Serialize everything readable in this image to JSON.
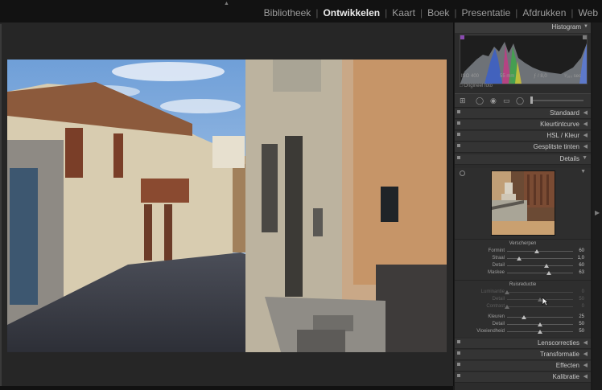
{
  "modules": {
    "items": [
      {
        "label": "Bibliotheek",
        "active": false
      },
      {
        "label": "Ontwikkelen",
        "active": true
      },
      {
        "label": "Kaart",
        "active": false
      },
      {
        "label": "Boek",
        "active": false
      },
      {
        "label": "Presentatie",
        "active": false
      },
      {
        "label": "Afdrukken",
        "active": false
      },
      {
        "label": "Web",
        "active": false
      }
    ],
    "separator": "|"
  },
  "histogram": {
    "title": "Histogram",
    "iso": "ISO 400",
    "focal": "55 mm",
    "aperture": "ƒ / 8,0",
    "shutter": "¹⁄₁₆₀ sec",
    "original_label": "Origineel foto"
  },
  "tool_icons": [
    "crop-icon",
    "spot-removal-icon",
    "red-eye-icon",
    "graduated-filter-icon",
    "radial-filter-icon",
    "adjustment-brush-icon"
  ],
  "sections_top": [
    {
      "label": "Standaard"
    },
    {
      "label": "Kleurtintcurve"
    },
    {
      "label": "HSL / Kleur"
    },
    {
      "label": "Gesplitste tinten"
    },
    {
      "label": "Details"
    }
  ],
  "details": {
    "sharpen": {
      "title": "Verscherpen",
      "rows": [
        {
          "label": "Formint",
          "value": "60",
          "pos": 0.45
        },
        {
          "label": "Straal",
          "value": "1,0",
          "pos": 0.18
        },
        {
          "label": "Detail",
          "value": "60",
          "pos": 0.6
        },
        {
          "label": "Maskee",
          "value": "63",
          "pos": 0.63
        }
      ]
    },
    "noise": {
      "title": "Ruisreductie",
      "rows": [
        {
          "label": "Luminantie",
          "value": "0",
          "pos": 0.0,
          "dim": true
        },
        {
          "label": "Detail",
          "value": "50",
          "pos": 0.5,
          "dim": true
        },
        {
          "label": "Contrast",
          "value": "0",
          "pos": 0.0,
          "dim": true
        },
        {
          "label": "Kleuren",
          "value": "25",
          "pos": 0.25,
          "dim": false
        },
        {
          "label": "Detail",
          "value": "50",
          "pos": 0.5,
          "dim": false
        },
        {
          "label": "Vloeiendheid",
          "value": "50",
          "pos": 0.5,
          "dim": false
        }
      ]
    }
  },
  "sections_bottom": [
    {
      "label": "Lenscorrecties"
    },
    {
      "label": "Transformatie"
    },
    {
      "label": "Effecten"
    },
    {
      "label": "Kalibratie"
    }
  ]
}
